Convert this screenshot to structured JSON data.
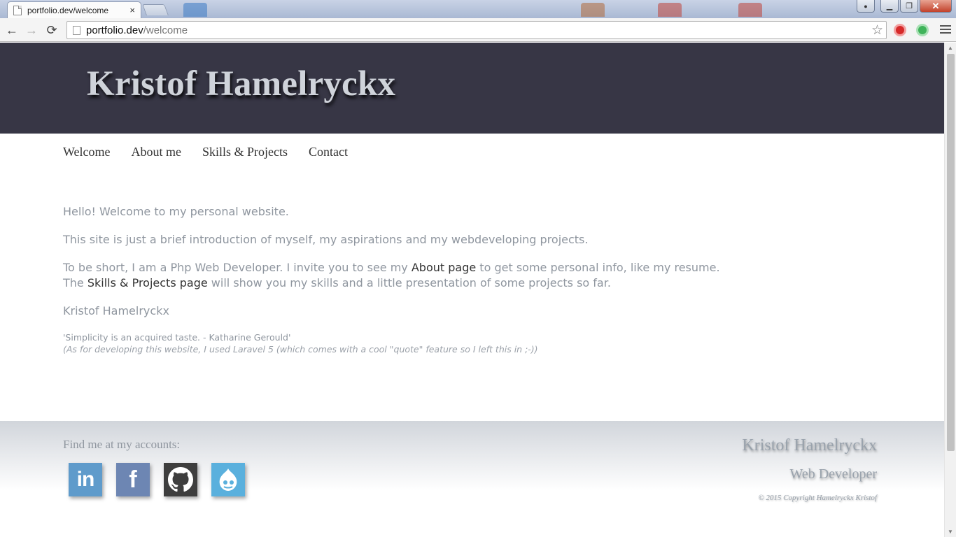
{
  "browser": {
    "tab_title": "portfolio.dev/welcome",
    "tab_close": "×",
    "url_host": "portfolio.dev",
    "url_path": "/welcome",
    "window_controls": {
      "minimize": "▁",
      "restore": "❐",
      "close": "✕",
      "user": "👤"
    },
    "nav": {
      "back": "←",
      "forward": "→",
      "reload": "⟳",
      "bookmark": "☆"
    }
  },
  "header": {
    "title": "Kristof Hamelryckx"
  },
  "nav": {
    "items": [
      "Welcome",
      "About me",
      "Skills & Projects",
      "Contact"
    ]
  },
  "content": {
    "greeting": "Hello! Welcome to my personal website.",
    "intro": "This site is just a brief introduction of myself, my aspirations and my webdeveloping projects.",
    "para3_pre": "To be short, I am a Php Web Developer. I invite you to see my ",
    "about_link": "About page",
    "para3_post": " to get some personal info, like my resume.",
    "para3_line2_pre": "The ",
    "skills_link": "Skills & Projects page",
    "para3_line2_post": " will show you my skills and a little presentation of some projects so far.",
    "signature": "Kristof Hamelryckx",
    "quote": "'Simplicity is an acquired taste. - Katharine Gerould'",
    "quote_note": "(As for developing this website, I used Laravel 5 (which comes with a cool \"quote\" feature so I left this in ;-))"
  },
  "footer": {
    "find_me": "Find me at my accounts:",
    "socials": [
      {
        "name": "linkedin-icon",
        "label": "in"
      },
      {
        "name": "facebook-icon",
        "label": "f"
      },
      {
        "name": "github-icon",
        "label": ""
      },
      {
        "name": "drupal-icon",
        "label": ""
      }
    ],
    "name": "Kristof Hamelryckx",
    "role": "Web Developer",
    "copyright": "© 2015 Copyright Hamelryckx Kristof"
  },
  "colors": {
    "header_bg": "#373645",
    "text_muted": "#8f969f",
    "link": "#333333",
    "linkedin": "#5f9bcb",
    "facebook": "#6d86b3",
    "github": "#3e3e3e",
    "drupal": "#5ab0dd"
  }
}
